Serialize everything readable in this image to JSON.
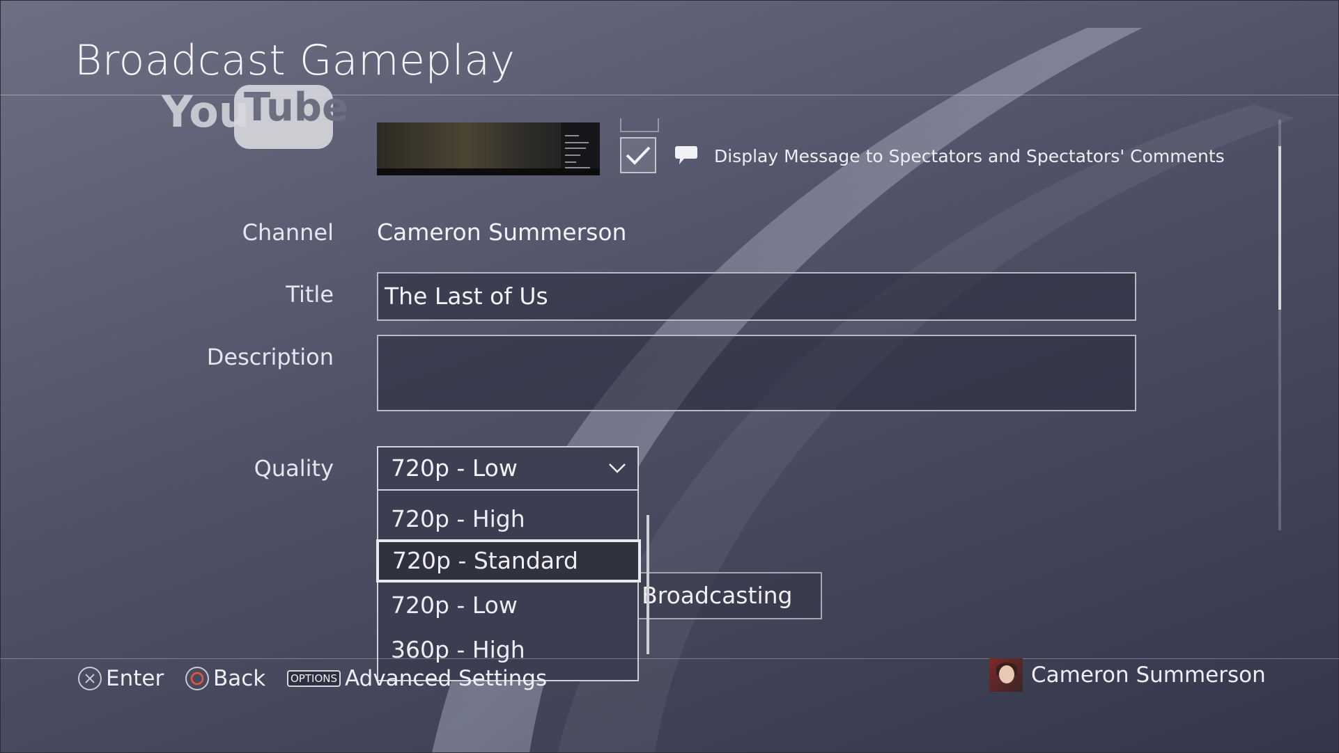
{
  "header": {
    "title": "Broadcast Gameplay"
  },
  "service": {
    "logo": "YouTube"
  },
  "comments_option": {
    "checked": true,
    "label": "Display Message to Spectators and Spectators' Comments",
    "icon": "speech-bubble-icon"
  },
  "form": {
    "channel_label": "Channel",
    "channel_value": "Cameron Summerson",
    "title_label": "Title",
    "title_value": "The Last of Us",
    "description_label": "Description",
    "description_value": "",
    "quality_label": "Quality",
    "quality_value": "720p - Low",
    "quality_options": [
      "720p - High",
      "720p - Standard",
      "720p - Low",
      "360p - High"
    ],
    "quality_highlighted": "720p - Standard"
  },
  "start_button": {
    "label": "Start Broadcasting"
  },
  "footer": {
    "enter_label": "Enter",
    "back_label": "Back",
    "options_glyph": "OPTIONS",
    "advanced_label": "Advanced Settings",
    "user_name": "Cameron Summerson"
  },
  "colors": {
    "background": "#4f5166",
    "panel": "#3b3d50",
    "highlight_border": "#e9e9ef",
    "circle_button": "#e8553b"
  }
}
